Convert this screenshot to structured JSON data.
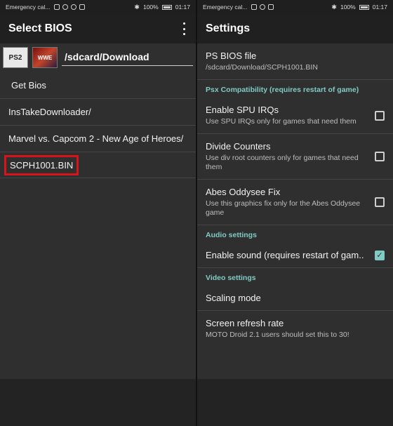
{
  "left": {
    "status": {
      "carrier": "Emergency cal...",
      "battery": "100%",
      "time": "01:17"
    },
    "title": "Select BIOS",
    "path": "/sdcard/Download",
    "thumb1": "PS2",
    "thumb2": "WWE",
    "get_bios": "Get Bios",
    "items": [
      "InsTakeDownloader/",
      "Marvel vs. Capcom 2 - New Age of Heroes/",
      "SCPH1001.BIN"
    ]
  },
  "right": {
    "status": {
      "carrier": "Emergency cal...",
      "battery": "100%",
      "time": "01:17"
    },
    "title": "Settings",
    "bios": {
      "title": "PS BIOS file",
      "summary": "/sdcard/Download/SCPH1001.BIN"
    },
    "cat_psx": "Psx Compatibility (requires restart of game)",
    "spu": {
      "title": "Enable SPU IRQs",
      "summary": "Use SPU IRQs only for games that need them"
    },
    "divide": {
      "title": "Divide Counters",
      "summary": "Use div root counters only for games that need them"
    },
    "abes": {
      "title": "Abes Oddysee Fix",
      "summary": "Use this graphics fix only for the Abes Oddysee game"
    },
    "cat_audio": "Audio settings",
    "sound": {
      "title": "Enable sound (requires restart of gam.."
    },
    "cat_video": "Video settings",
    "scaling": {
      "title": "Scaling mode"
    },
    "refresh": {
      "title": "Screen refresh rate",
      "summary": "MOTO Droid 2.1 users should set this to 30!"
    }
  },
  "colors": {
    "accent": "#80cbc4",
    "highlight": "#d5141c",
    "background": "#2f2f2f"
  }
}
